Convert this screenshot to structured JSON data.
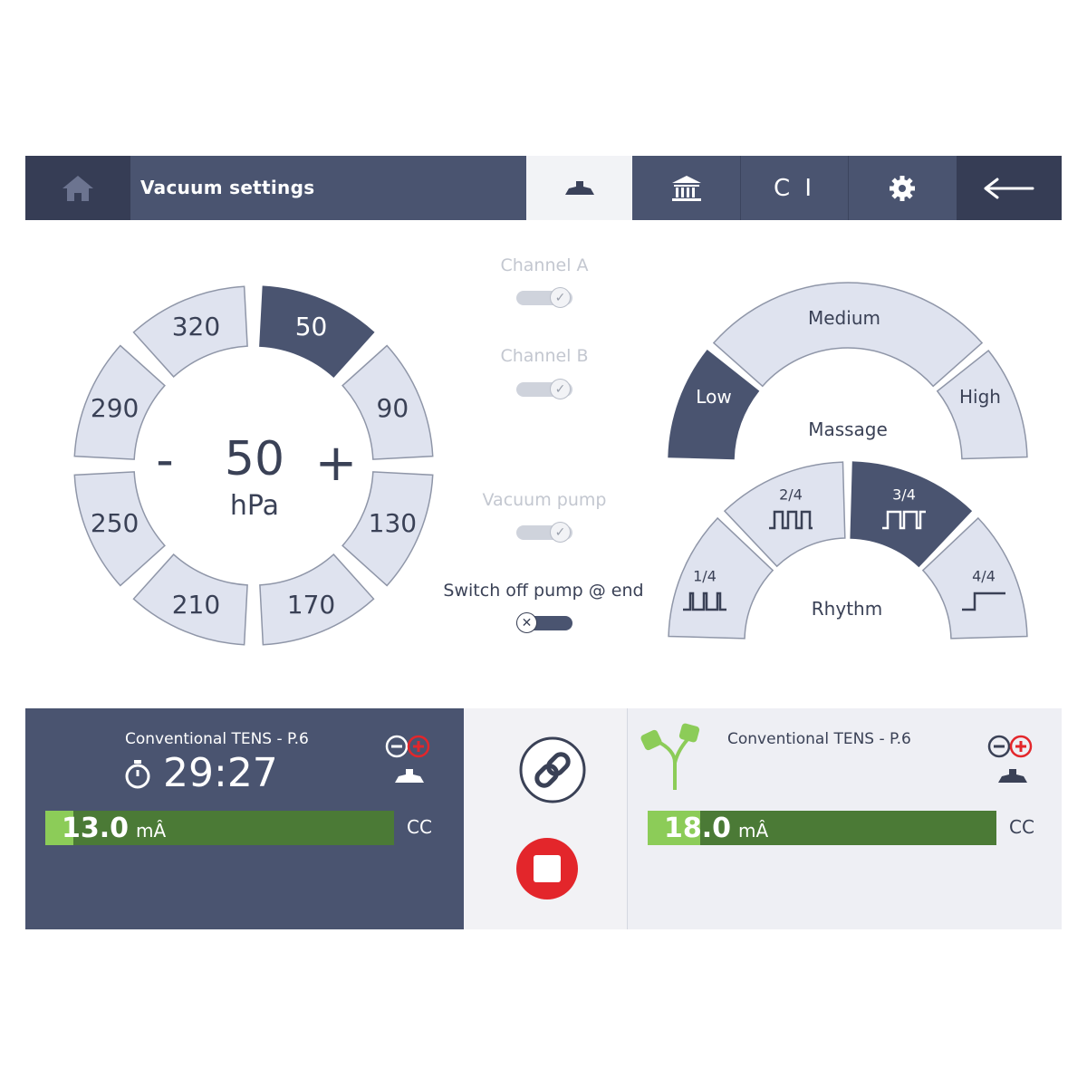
{
  "header": {
    "title": "Vacuum settings",
    "icons": [
      "home-icon",
      "vacuum-cup-icon",
      "library-icon",
      "ci-text",
      "gear-icon",
      "back-arrow-icon"
    ],
    "ci_label": "C I",
    "active_tab": "vacuum"
  },
  "pressure": {
    "value": "50",
    "unit": "hPa",
    "minus": "-",
    "plus": "+",
    "options": [
      {
        "label": "50",
        "selected": true
      },
      {
        "label": "90",
        "selected": false
      },
      {
        "label": "130",
        "selected": false
      },
      {
        "label": "170",
        "selected": false
      },
      {
        "label": "210",
        "selected": false
      },
      {
        "label": "250",
        "selected": false
      },
      {
        "label": "290",
        "selected": false
      },
      {
        "label": "320",
        "selected": false
      }
    ]
  },
  "toggles": {
    "channel_a": {
      "label": "Channel A",
      "state": "on",
      "enabled": false
    },
    "channel_b": {
      "label": "Channel B",
      "state": "on",
      "enabled": false
    },
    "vacuum_pump": {
      "label": "Vacuum pump",
      "state": "on",
      "enabled": false
    },
    "switch_off_pump": {
      "label": "Switch off pump @ end",
      "state": "off",
      "enabled": true
    }
  },
  "massage": {
    "title": "Massage",
    "options": [
      {
        "label": "Low",
        "selected": true
      },
      {
        "label": "Medium",
        "selected": false
      },
      {
        "label": "High",
        "selected": false
      }
    ]
  },
  "rhythm": {
    "title": "Rhythm",
    "options": [
      {
        "label": "1/4",
        "selected": false
      },
      {
        "label": "2/4",
        "selected": false
      },
      {
        "label": "3/4",
        "selected": true
      },
      {
        "label": "4/4",
        "selected": false
      }
    ]
  },
  "channel_left": {
    "program": "Conventional TENS - P.6",
    "timer": "29:27",
    "current": "13.0",
    "unit": "mÂ",
    "mode": "CC",
    "level_fraction": 0.08
  },
  "channel_right": {
    "program": "Conventional TENS - P.6",
    "current": "18.0",
    "unit": "mÂ",
    "mode": "CC",
    "level_fraction": 0.15
  },
  "colors": {
    "dark": "#4a5470",
    "segment": "#dfe3ef",
    "accent_green": "#4b7a36",
    "light_green": "#8ccc58",
    "stop_red": "#e3262b"
  }
}
